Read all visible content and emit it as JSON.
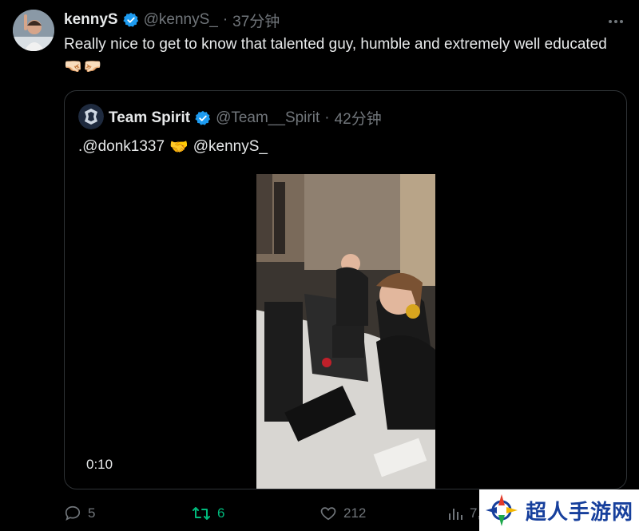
{
  "tweet": {
    "author_name": "kennyS",
    "author_handle": "@kennyS_",
    "separator": "·",
    "time": "37分钟",
    "text": "Really nice to get to know that talented guy, humble and extremely well educated 🤜🏻🤛🏻",
    "more_icon": "more-horizontal-icon"
  },
  "quoted": {
    "author_name": "Team Spirit",
    "author_handle": "@Team__Spirit",
    "separator": "·",
    "time": "42分钟",
    "text_pre": ".@donk1337",
    "emoji": "🤝",
    "text_post": "@kennyS_",
    "video_timestamp": "0:10"
  },
  "actions": {
    "reply_count": "5",
    "retweet_count": "6",
    "like_count": "212",
    "views_count": "7,"
  },
  "watermark": {
    "text": "超人手游网"
  },
  "colors": {
    "background": "#000000",
    "text": "#e7e9ea",
    "muted": "#71767b",
    "verified": "#1d9bf0",
    "retweet_active": "#00ba7c",
    "border": "#2f3336"
  }
}
